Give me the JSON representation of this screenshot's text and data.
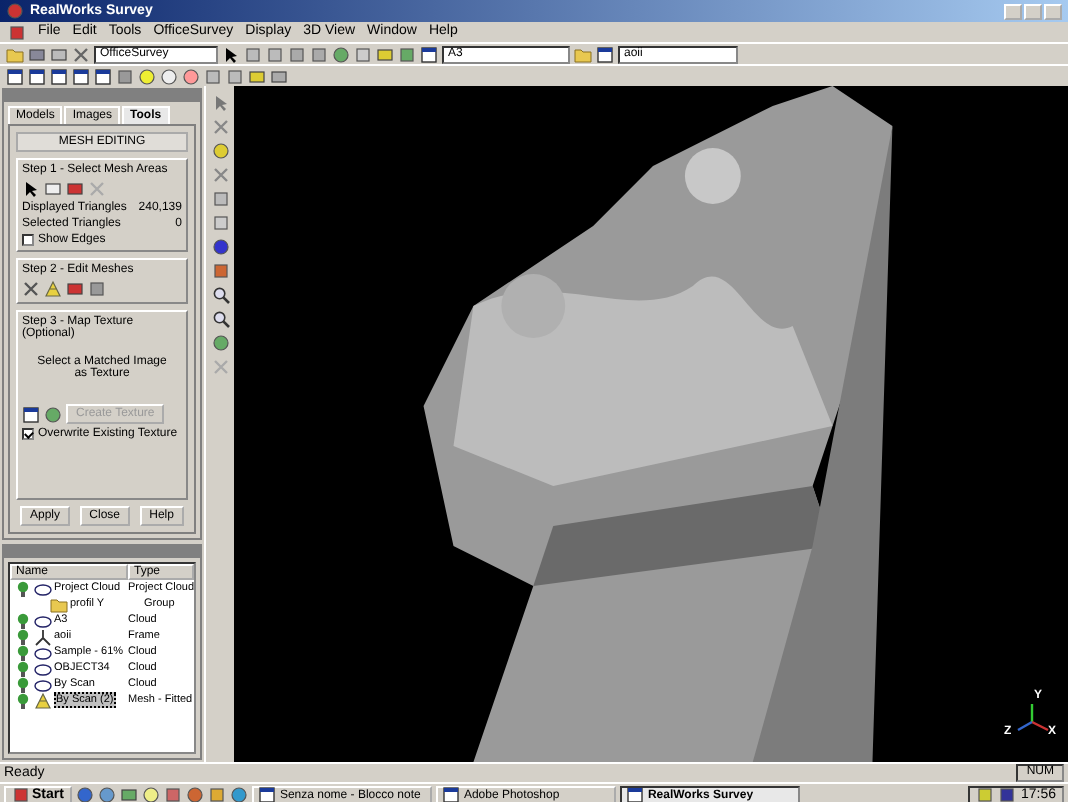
{
  "window": {
    "title": "RealWorks Survey"
  },
  "menu": [
    "File",
    "Edit",
    "Tools",
    "OfficeSurvey",
    "Display",
    "3D View",
    "Window",
    "Help"
  ],
  "toolbar": {
    "mode_combo": "OfficeSurvey",
    "sheet_combo": "A3",
    "layer_combo": "aoii"
  },
  "left_panel": {
    "tabs": [
      {
        "label": "Models",
        "selected": false
      },
      {
        "label": "Images",
        "selected": false
      },
      {
        "label": "Tools",
        "selected": true
      }
    ],
    "title": "MESH EDITING",
    "step1": {
      "label": "Step 1 - Select Mesh Areas",
      "stats": [
        {
          "label": "Displayed Triangles",
          "value": "240,139"
        },
        {
          "label": "Selected Triangles",
          "value": "0"
        }
      ],
      "show_edges": {
        "label": "Show Edges",
        "checked": false
      }
    },
    "step2": {
      "label": "Step 2 - Edit Meshes"
    },
    "step3": {
      "label": "Step 3 - Map Texture (Optional)",
      "hint": "Select a Matched Image as Texture",
      "texture_button": {
        "label": "Create Texture",
        "disabled": true
      },
      "overwrite": {
        "label": "Overwrite Existing Texture",
        "checked": true
      }
    },
    "buttons": [
      "Apply",
      "Close",
      "Help"
    ]
  },
  "tree": {
    "columns": [
      "Name",
      "Type"
    ],
    "rows": [
      {
        "name": "Project Cloud",
        "type": "Project Cloud",
        "kind": "cloud",
        "visible": true,
        "selected": false,
        "children": [
          {
            "name": "profil Y",
            "type": "Group",
            "kind": "group",
            "visible": false,
            "selected": false
          }
        ]
      },
      {
        "name": "A3",
        "type": "Cloud",
        "kind": "cloud",
        "visible": true,
        "selected": false
      },
      {
        "name": "aoii",
        "type": "Frame",
        "kind": "frame",
        "visible": true,
        "selected": false
      },
      {
        "name": "Sample - 61%",
        "type": "Cloud",
        "kind": "cloud",
        "visible": true,
        "selected": false
      },
      {
        "name": "OBJECT34",
        "type": "Cloud",
        "kind": "cloud",
        "visible": true,
        "selected": false
      },
      {
        "name": "By Scan",
        "type": "Cloud",
        "kind": "cloud",
        "visible": true,
        "selected": false
      },
      {
        "name": "By Scan (2)",
        "type": "Mesh - Fitted",
        "kind": "mesh",
        "visible": true,
        "selected": true
      }
    ]
  },
  "viewport": {
    "axes": [
      "Y",
      "Z",
      "X"
    ]
  },
  "status_bar": {
    "message": "Ready",
    "indicator": "NUM"
  },
  "taskbar": {
    "start": "Start",
    "tasks": [
      {
        "label": "Senza nome - Blocco note",
        "selected": false
      },
      {
        "label": "Adobe Photoshop",
        "selected": false
      },
      {
        "label": "RealWorks Survey",
        "selected": true
      }
    ],
    "clock": "17:56"
  }
}
